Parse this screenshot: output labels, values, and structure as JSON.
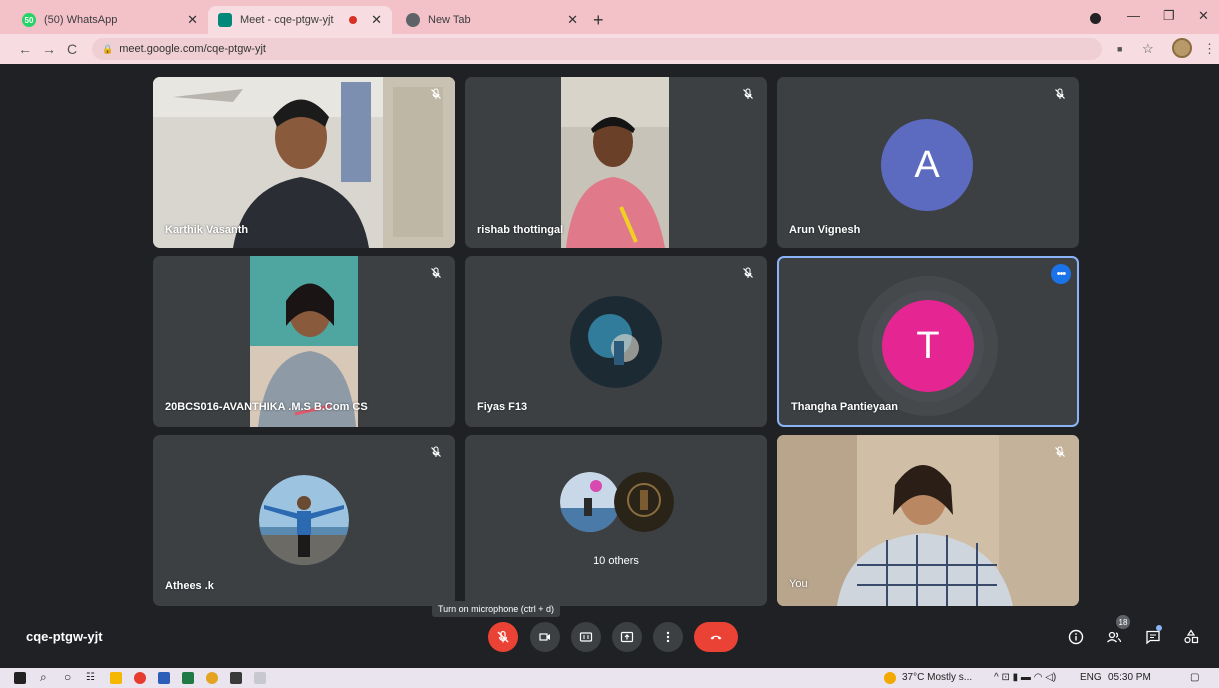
{
  "browser": {
    "tabs": [
      {
        "title": "(50) WhatsApp",
        "icon": "whatsapp-icon",
        "color": "#25d366"
      },
      {
        "title": "Meet - cqe-ptgw-yjt",
        "icon": "meet-icon",
        "color": "#00897b"
      },
      {
        "title": "New Tab",
        "icon": "chrome-icon",
        "color": "#5f6368"
      }
    ],
    "url": "meet.google.com/cqe-ptgw-yjt"
  },
  "participants": [
    {
      "name": "Karthik Vasanth",
      "type": "video",
      "muted": true
    },
    {
      "name": "rishab thottingal",
      "type": "video",
      "muted": true
    },
    {
      "name": "Arun Vignesh",
      "type": "letter",
      "letter": "A",
      "color": "#5c6bc0",
      "muted": true
    },
    {
      "name": "20BCS016-AVANTHIKA .M.S B.Com CS",
      "type": "video",
      "muted": true
    },
    {
      "name": "Fiyas F13",
      "type": "photo",
      "muted": true
    },
    {
      "name": "Thangha Pantieyaan",
      "type": "letter",
      "letter": "T",
      "color": "#e52592",
      "muted": false,
      "speaking": true
    },
    {
      "name": "Athees .k",
      "type": "photo",
      "muted": true
    },
    {
      "name": "10 others",
      "type": "group"
    },
    {
      "name": "You",
      "type": "video",
      "muted": true
    }
  ],
  "tooltip": "Turn on microphone (ctrl + d)",
  "meeting_code": "cqe-ptgw-yjt",
  "people_count": "18",
  "colors": {
    "accent": "#1a73e8",
    "danger": "#ea4335",
    "tile": "#3c4043",
    "background": "#202124"
  },
  "taskbar": {
    "weather": "37°C  Mostly s...",
    "lang": "ENG",
    "time": "05:30 PM"
  }
}
